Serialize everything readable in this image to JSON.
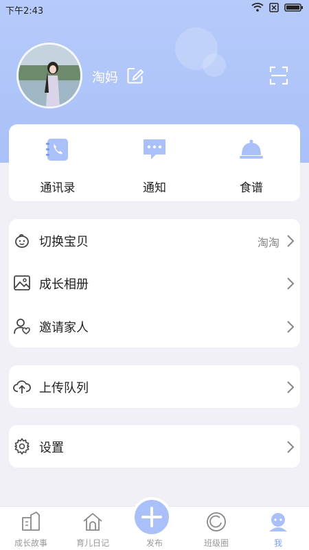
{
  "status_bar": {
    "time": "下午2:43"
  },
  "profile": {
    "username": "淘妈"
  },
  "quick_actions": [
    {
      "label": "通讯录",
      "icon": "contacts-icon"
    },
    {
      "label": "通知",
      "icon": "notification-icon"
    },
    {
      "label": "食谱",
      "icon": "recipe-icon"
    }
  ],
  "menu": {
    "switch_baby": {
      "label": "切换宝贝",
      "value": "淘淘"
    },
    "album": {
      "label": "成长相册"
    },
    "invite": {
      "label": "邀请家人"
    },
    "upload": {
      "label": "上传队列"
    },
    "settings": {
      "label": "设置"
    }
  },
  "tabbar": {
    "items": [
      {
        "label": "成长故事"
      },
      {
        "label": "育儿日记"
      },
      {
        "label": "发布"
      },
      {
        "label": "班级圈"
      },
      {
        "label": "我"
      }
    ],
    "active_color": "#7a9cf0",
    "inactive_color": "#999999"
  },
  "colors": {
    "accent": "#a9c0f8",
    "header": "#b7cbfa",
    "background": "#f1f0f6"
  }
}
